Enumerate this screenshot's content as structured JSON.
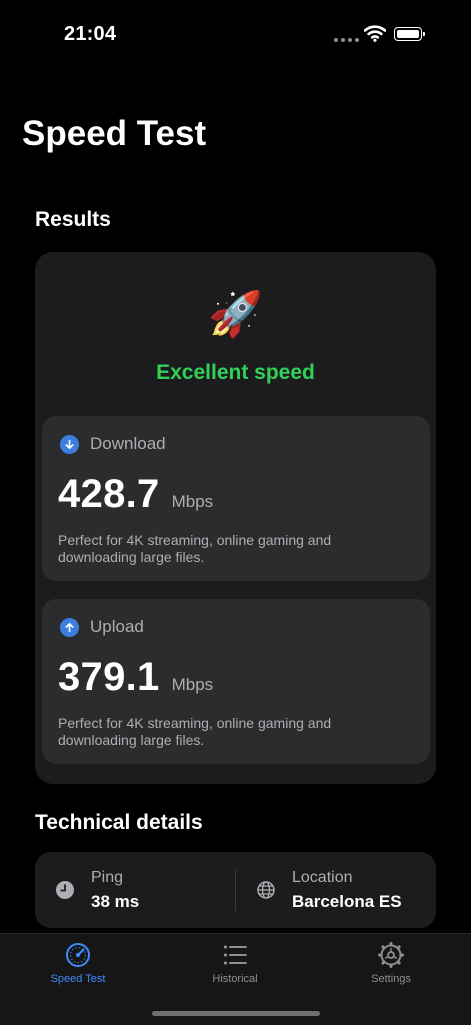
{
  "status_bar": {
    "time": "21:04"
  },
  "page_title": "Speed Test",
  "results": {
    "section_title": "Results",
    "verdict_icon": "rocket-icon",
    "verdict": "Excellent speed",
    "download": {
      "icon": "arrow-down-circle-icon",
      "label": "Download",
      "value": "428.7",
      "unit": "Mbps",
      "description": "Perfect for 4K streaming, online gaming and downloading large files."
    },
    "upload": {
      "icon": "arrow-up-circle-icon",
      "label": "Upload",
      "value": "379.1",
      "unit": "Mbps",
      "description": "Perfect for 4K streaming, online gaming and downloading large files."
    }
  },
  "technical_details": {
    "section_title": "Technical details",
    "ping": {
      "icon": "clock-icon",
      "label": "Ping",
      "value": "38 ms"
    },
    "location": {
      "icon": "globe-icon",
      "label": "Location",
      "value": "Barcelona ES"
    }
  },
  "tab_bar": {
    "items": [
      {
        "label": "Speed Test",
        "icon": "speedometer-icon",
        "active": true
      },
      {
        "label": "Historical",
        "icon": "list-icon",
        "active": false
      },
      {
        "label": "Settings",
        "icon": "gear-icon",
        "active": false
      }
    ]
  },
  "colors": {
    "background": "#000000",
    "card": "#1c1c1e",
    "inner_card": "#2c2c2e",
    "accent_green": "#30d158",
    "accent_blue": "#3d8bff",
    "secondary_text": "#aeaeb2"
  }
}
